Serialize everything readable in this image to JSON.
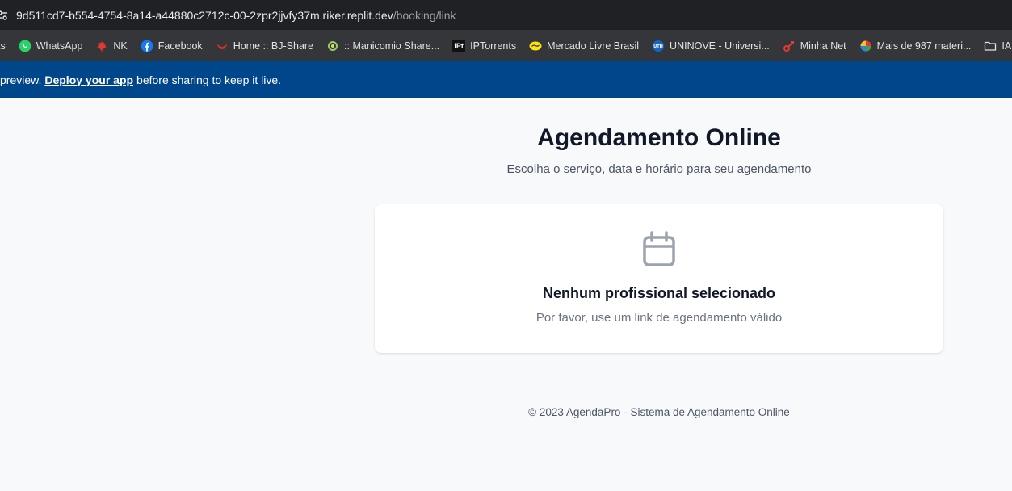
{
  "browser": {
    "url_host": "9d511cd7-b554-4754-8a14-a44880c2712c-00-2zpr2jjvfy37m.riker.replit.dev",
    "url_path": "/booking/link",
    "bookmarks": [
      {
        "label": "ts",
        "icon": "truncated"
      },
      {
        "label": "WhatsApp",
        "icon": "whatsapp-icon"
      },
      {
        "label": "NK",
        "icon": "maple-leaf-icon"
      },
      {
        "label": "Facebook",
        "icon": "facebook-icon"
      },
      {
        "label": "Home :: BJ-Share",
        "icon": "bj-share-icon"
      },
      {
        "label": ":: Manicomio Share...",
        "icon": "manicomio-icon"
      },
      {
        "label": "IPTorrents",
        "icon": "iptorrents-icon"
      },
      {
        "label": "Mercado Livre Brasil",
        "icon": "mercado-livre-icon"
      },
      {
        "label": "UNINOVE - Universi...",
        "icon": "uninove-icon"
      },
      {
        "label": "Minha Net",
        "icon": "minha-net-icon"
      },
      {
        "label": "Mais de 987 materi...",
        "icon": "colorful-ball-icon"
      },
      {
        "label": "IA",
        "icon": "folder-icon"
      },
      {
        "label": "",
        "icon": "folder-icon"
      }
    ]
  },
  "banner": {
    "text_before": "preview.",
    "link": "Deploy your app",
    "text_after": "before sharing to keep it live."
  },
  "page": {
    "title": "Agendamento Online",
    "subtitle": "Escolha o serviço, data e horário para seu agendamento",
    "card": {
      "icon": "calendar-icon",
      "title": "Nenhum profissional selecionado",
      "text": "Por favor, use um link de agendamento válido"
    },
    "footer": "© 2023 AgendaPro - Sistema de Agendamento Online"
  },
  "colors": {
    "browser_bg": "#202124",
    "bookmarks_bg": "#35363a",
    "banner_bg": "#00468a",
    "page_bg": "#f8f9fb",
    "card_bg": "#ffffff",
    "icon_gray": "#9ca3af"
  }
}
